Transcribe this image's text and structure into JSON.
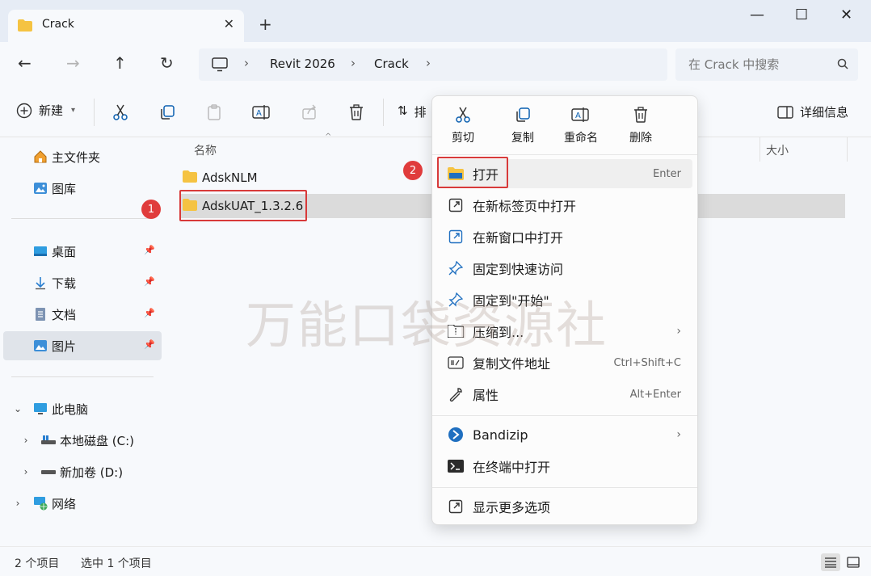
{
  "window": {
    "tab_title": "Crack",
    "tab_close": "✕",
    "new_tab": "+",
    "minimize": "—",
    "maximize": "☐",
    "close": "✕"
  },
  "nav": {
    "breadcrumb": [
      "Revit 2026",
      "Crack"
    ],
    "search_placeholder": "在 Crack 中搜索"
  },
  "toolbar": {
    "new_label": "新建",
    "sort_label": "排",
    "details_label": "详细信息"
  },
  "sidebar": {
    "quick": [
      {
        "label": "主文件夹",
        "icon": "home-icon"
      },
      {
        "label": "图库",
        "icon": "gallery-icon"
      }
    ],
    "pinned": [
      {
        "label": "桌面",
        "icon": "desktop-icon"
      },
      {
        "label": "下载",
        "icon": "download-icon"
      },
      {
        "label": "文档",
        "icon": "document-icon"
      },
      {
        "label": "图片",
        "icon": "pictures-icon"
      }
    ],
    "tree": [
      {
        "label": "此电脑",
        "icon": "pc-icon",
        "expanded": true
      },
      {
        "label": "本地磁盘 (C:)",
        "icon": "drive-icon"
      },
      {
        "label": "新加卷 (D:)",
        "icon": "drive-icon"
      },
      {
        "label": "网络",
        "icon": "network-icon"
      }
    ]
  },
  "content": {
    "columns": [
      "名称",
      "大小"
    ],
    "rows": [
      {
        "name": "AdskNLM",
        "selected": false
      },
      {
        "name": "AdskUAT_1.3.2.6",
        "selected": true
      }
    ]
  },
  "context_menu": {
    "top_actions": [
      {
        "label": "剪切",
        "icon": "cut-icon"
      },
      {
        "label": "复制",
        "icon": "copy-icon"
      },
      {
        "label": "重命名",
        "icon": "rename-icon"
      },
      {
        "label": "删除",
        "icon": "delete-icon"
      }
    ],
    "items": [
      {
        "label": "打开",
        "shortcut": "Enter",
        "icon": "folder-open-icon"
      },
      {
        "label": "在新标签页中打开",
        "shortcut": "",
        "icon": "new-tab-icon"
      },
      {
        "label": "在新窗口中打开",
        "shortcut": "",
        "icon": "new-window-icon"
      },
      {
        "label": "固定到快速访问",
        "shortcut": "",
        "icon": "pin-icon"
      },
      {
        "label": "固定到\"开始\"",
        "shortcut": "",
        "icon": "pin-start-icon"
      },
      {
        "label": "压缩到...",
        "shortcut": "",
        "icon": "zip-icon"
      },
      {
        "label": "复制文件地址",
        "shortcut": "Ctrl+Shift+C",
        "icon": "copy-path-icon"
      },
      {
        "label": "属性",
        "shortcut": "Alt+Enter",
        "icon": "wrench-icon"
      },
      {
        "label": "Bandizip",
        "shortcut": "",
        "icon": "bandizip-icon"
      },
      {
        "label": "在终端中打开",
        "shortcut": "",
        "icon": "terminal-icon"
      },
      {
        "label": "显示更多选项",
        "shortcut": "",
        "icon": "more-options-icon"
      }
    ]
  },
  "status": {
    "count": "2 个项目",
    "selected": "选中 1 个项目"
  },
  "annotations": {
    "step1": "1",
    "step2": "2"
  },
  "watermark": "万能口袋资源社",
  "colors": {
    "folder": "#f5c342",
    "highlight": "#d83a3a",
    "accent": "#0067c0"
  }
}
